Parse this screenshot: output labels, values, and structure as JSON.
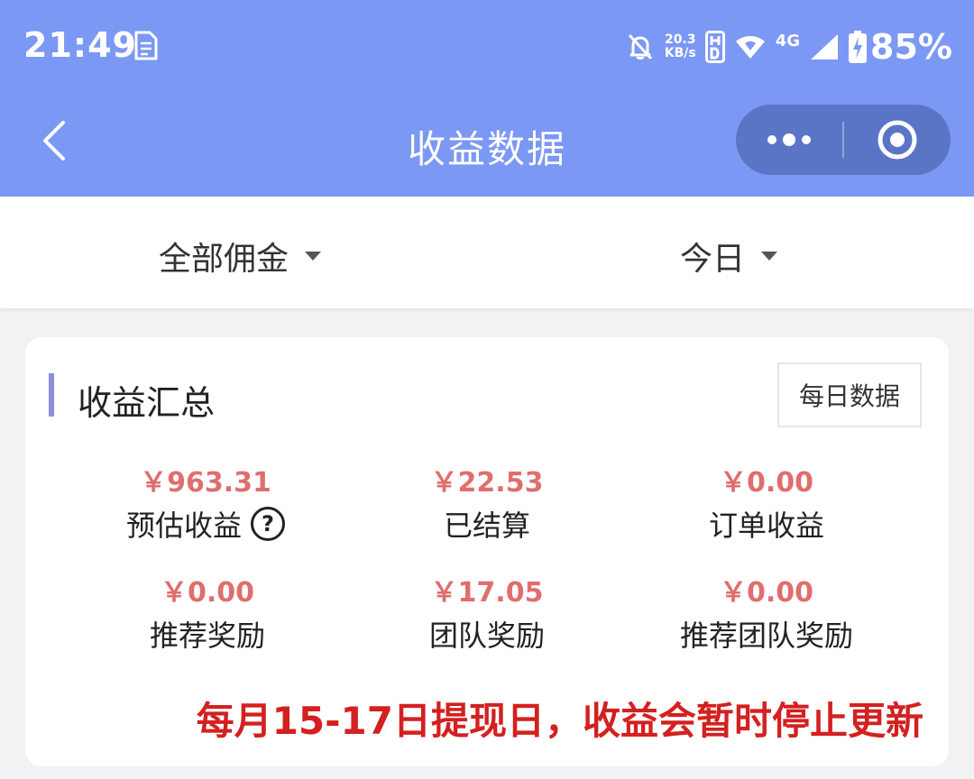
{
  "status_bar": {
    "time": "21:49",
    "net_speed_value": "20.3",
    "net_speed_unit": "KB/s",
    "network_type": "4G",
    "battery": "85%"
  },
  "header": {
    "title": "收益数据"
  },
  "filters": {
    "commission": "全部佣金",
    "date_range": "今日"
  },
  "summary": {
    "title": "收益汇总",
    "daily_button": "每日数据",
    "stats": [
      {
        "value": "￥963.31",
        "label": "预估收益"
      },
      {
        "value": "￥22.53",
        "label": "已结算"
      },
      {
        "value": "￥0.00",
        "label": "订单收益"
      },
      {
        "value": "￥0.00",
        "label": "推荐奖励"
      },
      {
        "value": "￥17.05",
        "label": "团队奖励"
      },
      {
        "value": "￥0.00",
        "label": "推荐团队奖励"
      }
    ],
    "help_icon_glyph": "?",
    "notice": "每月15-17日提现日，收益会暂时停止更新"
  },
  "colors": {
    "header_bg": "#7b98f4",
    "capsule_bg": "#5b75c6",
    "value_red": "#e06e6e",
    "notice_red": "#d42020",
    "accent_bar": "#8d8fd6"
  }
}
